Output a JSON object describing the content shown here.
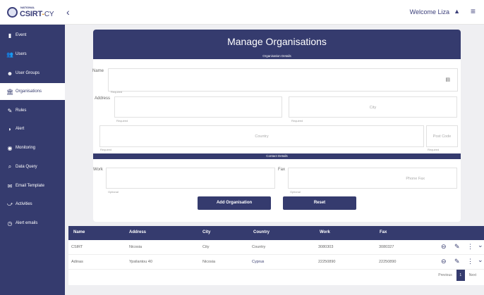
{
  "header": {
    "logo_small": "NATIONAL",
    "logo_csirt": "CSIRT",
    "logo_dash": "-",
    "logo_cy": "CY",
    "collapse_icon": "‹",
    "welcome": "Welcome Liza",
    "bell_icon": "🔔",
    "menu_icon": "≡"
  },
  "sidebar": {
    "items": [
      {
        "icon": "file-icon",
        "glyph": "▮",
        "label": "Event"
      },
      {
        "icon": "users-icon",
        "glyph": "👥",
        "label": "Users"
      },
      {
        "icon": "user-groups-icon",
        "glyph": "☻",
        "label": "User Groups"
      },
      {
        "icon": "bank-icon",
        "glyph": "🏛",
        "label": "Organisations"
      },
      {
        "icon": "pencil-icon",
        "glyph": "✎",
        "label": "Rules"
      },
      {
        "icon": "tag-icon",
        "glyph": "◗",
        "label": "Alert"
      },
      {
        "icon": "dashboard-icon",
        "glyph": "◉",
        "label": "Monitoring"
      },
      {
        "icon": "search-icon",
        "glyph": "⌕",
        "label": "Data Query"
      },
      {
        "icon": "mail-icon",
        "glyph": "✉",
        "label": "Email Template"
      },
      {
        "icon": "activity-icon",
        "glyph": "⤻",
        "label": "Activities"
      },
      {
        "icon": "clock-icon",
        "glyph": "◷",
        "label": "Alert emails"
      }
    ],
    "active_index": 3
  },
  "form": {
    "title": "Manage Organisations",
    "section_org": "Organisation Details",
    "name_label": "Name",
    "name_hint": "Required",
    "name_icon": "▤",
    "address_label": "Address",
    "address_hint": "Required",
    "city_placeholder": "City",
    "city_hint": "Required",
    "country_placeholder": "Country",
    "country_hint": "Required",
    "postcode_placeholder": "Post Code",
    "postcode_hint": "Required",
    "section_contact": "Contact Details",
    "work_label": "Work",
    "work_hint": "Optional",
    "fax_label": "Fax",
    "fax_placeholder": "Phone Fax",
    "fax_hint": "Optional",
    "add_button": "Add Organisation",
    "reset_button": "Reset"
  },
  "table": {
    "columns": [
      "Name",
      "Address",
      "City",
      "Country",
      "Work",
      "Fax"
    ],
    "rows": [
      [
        "CSIRT",
        "Nicosia",
        "City",
        "Country",
        "3080303",
        "3080327"
      ],
      [
        "Adinas",
        "Ypsilantou 40",
        "Nicosia",
        "Cyprus",
        "22250890",
        "22250890"
      ]
    ],
    "row_actions": {
      "remove": "⊖",
      "edit": "✎",
      "more": "⋮",
      "expand": "⌄"
    },
    "pagination": {
      "previous": "Previous",
      "page": "1",
      "next": "Next"
    }
  }
}
